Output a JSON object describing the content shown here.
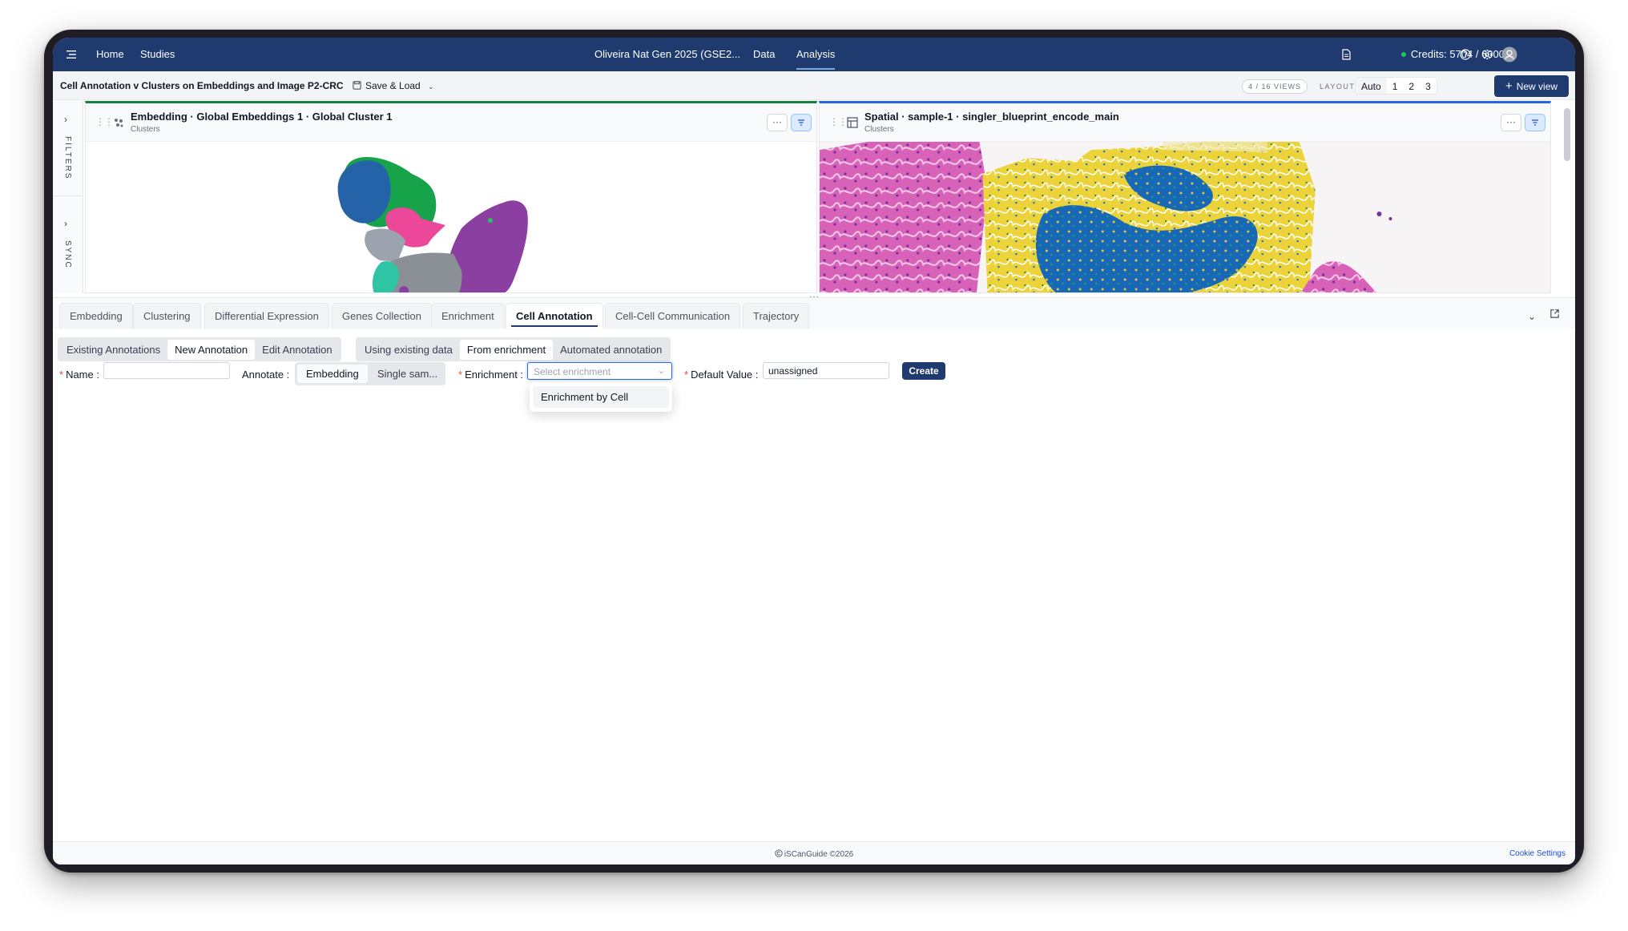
{
  "topnav": {
    "home": "Home",
    "studies": "Studies",
    "study": "Oliveira Nat Gen 2025 (GSE2...",
    "data": "Data",
    "analysis": "Analysis",
    "credits": "Credits: 5704 / 6000",
    "accent": "#1e3a6e"
  },
  "header": {
    "title": "Cell Annotation v Clusters on Embeddings and Image P2-CRC",
    "save_load": "Save & Load",
    "views": "4 / 16 VIEWS",
    "layout_label": "LAYOUT",
    "layout_options": [
      "Auto",
      "1",
      "2",
      "3"
    ],
    "new_view": "New view"
  },
  "side": {
    "filters": "FILTERS",
    "sync": "SYNC"
  },
  "panels": {
    "left": {
      "title": "Embedding · Global Embeddings 1 · Global Cluster 1",
      "subtitle": "Clusters",
      "more": "···"
    },
    "right": {
      "title": "Spatial · sample-1 · singler_blueprint_encode_main",
      "subtitle": "Clusters",
      "more": "···"
    }
  },
  "tabs": [
    "Embedding",
    "Clustering",
    "Differential Expression",
    "Genes Collection",
    "Enrichment",
    "Cell Annotation",
    "Cell-Cell Communication",
    "Trajectory"
  ],
  "subtabs": {
    "mode": [
      "Existing Annotations",
      "New Annotation",
      "Edit Annotation"
    ],
    "source": [
      "Using existing data",
      "From enrichment",
      "Automated annotation"
    ]
  },
  "form": {
    "name_label": "Name",
    "name_value": "",
    "annotate_label": "Annotate",
    "annotate_options": [
      "Embedding",
      "Single sam..."
    ],
    "enrichment_label": "Enrichment",
    "enrichment_placeholder": "Select enrichment",
    "default_label": "Default Value",
    "default_value": "unassigned",
    "create": "Create"
  },
  "dropdown": {
    "options": [
      "Enrichment by Cell"
    ]
  },
  "footer": {
    "copyright": "iSCanGuide ©2026",
    "cookie": "Cookie Settings"
  }
}
